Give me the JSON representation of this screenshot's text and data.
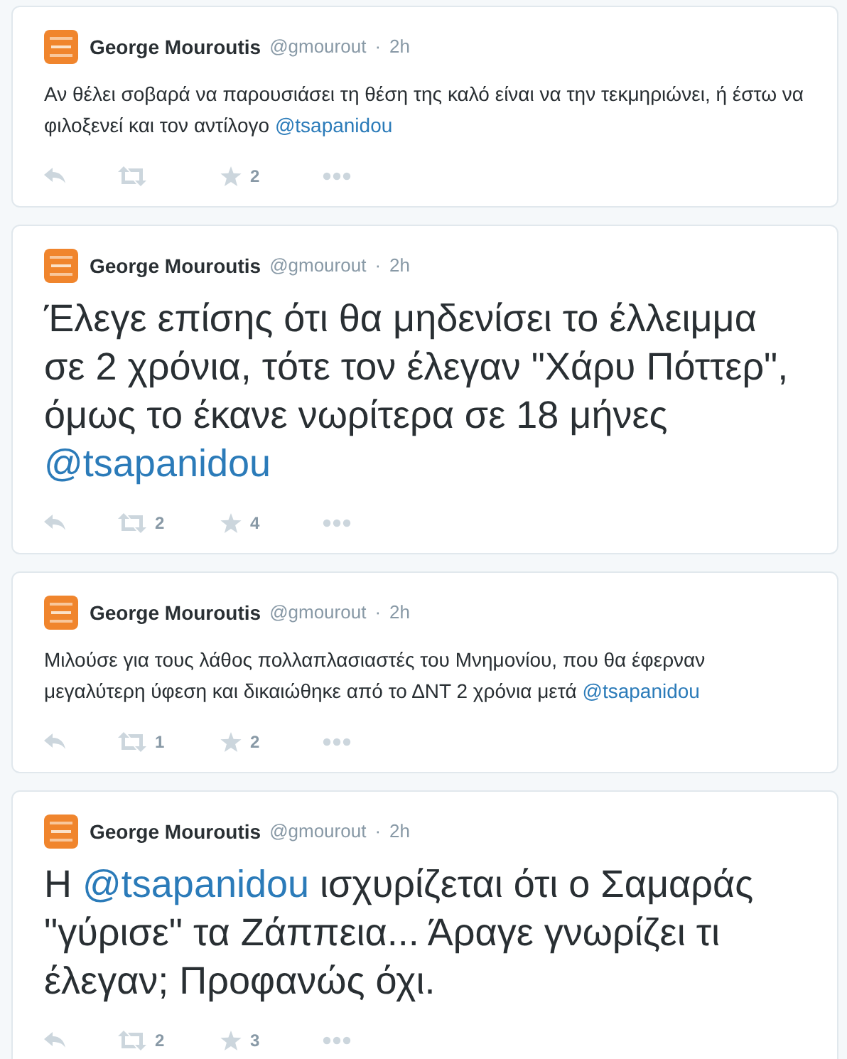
{
  "tweets": [
    {
      "name": "George Mouroutis",
      "handle": "@gmourout",
      "separator": "·",
      "time": "2h",
      "large": false,
      "segments": [
        {
          "kind": "text",
          "text": "Αν θέλει σοβαρά να παρουσιάσει τη θέση της καλό είναι να την τεκμηριώνει, ή έστω να φιλοξενεί και τον αντίλογο "
        },
        {
          "kind": "mention",
          "text": "@tsapanidou"
        }
      ],
      "favorites": "2"
    },
    {
      "name": "George Mouroutis",
      "handle": "@gmourout",
      "separator": "·",
      "time": "2h",
      "large": true,
      "segments": [
        {
          "kind": "text",
          "text": "Έλεγε επίσης ότι θα μηδενίσει το έλλειμμα σε 2 χρόνια, τότε τον έλεγαν \"Χάρυ Πόττερ\", όμως το έκανε νωρίτερα σε 18 μήνες "
        },
        {
          "kind": "mention",
          "text": "@tsapanidou"
        }
      ],
      "retweets": "2",
      "favorites": "4"
    },
    {
      "name": "George Mouroutis",
      "handle": "@gmourout",
      "separator": "·",
      "time": "2h",
      "large": false,
      "segments": [
        {
          "kind": "text",
          "text": "Μιλούσε για τους λάθος πολλαπλασιαστές του Μνημονίου, που θα έφερναν μεγαλύτερη ύφεση και δικαιώθηκε από το ΔΝΤ 2 χρόνια μετά "
        },
        {
          "kind": "mention",
          "text": "@tsapanidou"
        }
      ],
      "retweets": "1",
      "favorites": "2"
    },
    {
      "name": "George Mouroutis",
      "handle": "@gmourout",
      "separator": "·",
      "time": "2h",
      "large": true,
      "segments": [
        {
          "kind": "text",
          "text": "Η "
        },
        {
          "kind": "mention",
          "text": "@tsapanidou"
        },
        {
          "kind": "text",
          "text": " ισχυρίζεται ότι ο Σαμαράς \"γύρισε\" τα Ζάππεια... Άραγε γνωρίζει τι έλεγαν; Προφανώς όχι."
        }
      ],
      "retweets": "2",
      "favorites": "3"
    }
  ]
}
